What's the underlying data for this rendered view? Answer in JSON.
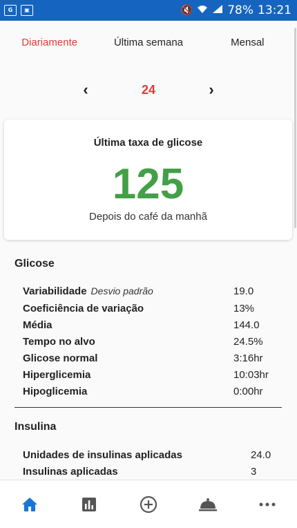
{
  "status_bar": {
    "battery": "78%",
    "time": "13:21",
    "left_icons": [
      "gallery-icon",
      "screenshot-icon"
    ],
    "right_icons": [
      "mute-icon",
      "wifi-icon",
      "signal-icon"
    ]
  },
  "tabs": [
    {
      "label": "Diariamente",
      "active": true
    },
    {
      "label": "Última semana",
      "active": false
    },
    {
      "label": "Mensal",
      "active": false
    }
  ],
  "day_nav": {
    "prev": "‹",
    "current": "24",
    "next": "›"
  },
  "last_glucose": {
    "title": "Última taxa de glicose",
    "value": "125",
    "context": "Depois do café da manhã",
    "value_color": "#43a047"
  },
  "glucose": {
    "title": "Glicose",
    "rows": [
      {
        "label": "Variabilidade",
        "hint": "Desvio padrão",
        "value": "19.0"
      },
      {
        "label": "Coeficiência de variação",
        "value": "13%"
      },
      {
        "label": "Média",
        "value": "144.0"
      },
      {
        "label": "Tempo no alvo",
        "value": "24.5%"
      },
      {
        "label": "Glicose normal",
        "value": "3:16hr"
      },
      {
        "label": "Hiperglicemia",
        "value": "10:03hr"
      },
      {
        "label": "Hipoglicemia",
        "value": "0:00hr"
      }
    ]
  },
  "insulin": {
    "title": "Insulina",
    "rows": [
      {
        "label": "Unidades de insulinas aplicadas",
        "value": "24.0"
      },
      {
        "label": "Insulinas aplicadas",
        "value": "3"
      }
    ]
  },
  "bottom_nav": [
    {
      "icon": "home-icon",
      "active": true
    },
    {
      "icon": "chart-icon",
      "active": false
    },
    {
      "icon": "add-circle-icon",
      "active": false
    },
    {
      "icon": "food-cloche-icon",
      "active": false
    },
    {
      "icon": "more-icon",
      "active": false
    }
  ],
  "colors": {
    "status_bar": "#1565c0",
    "accent": "#e53935",
    "active_nav": "#1976d2"
  }
}
